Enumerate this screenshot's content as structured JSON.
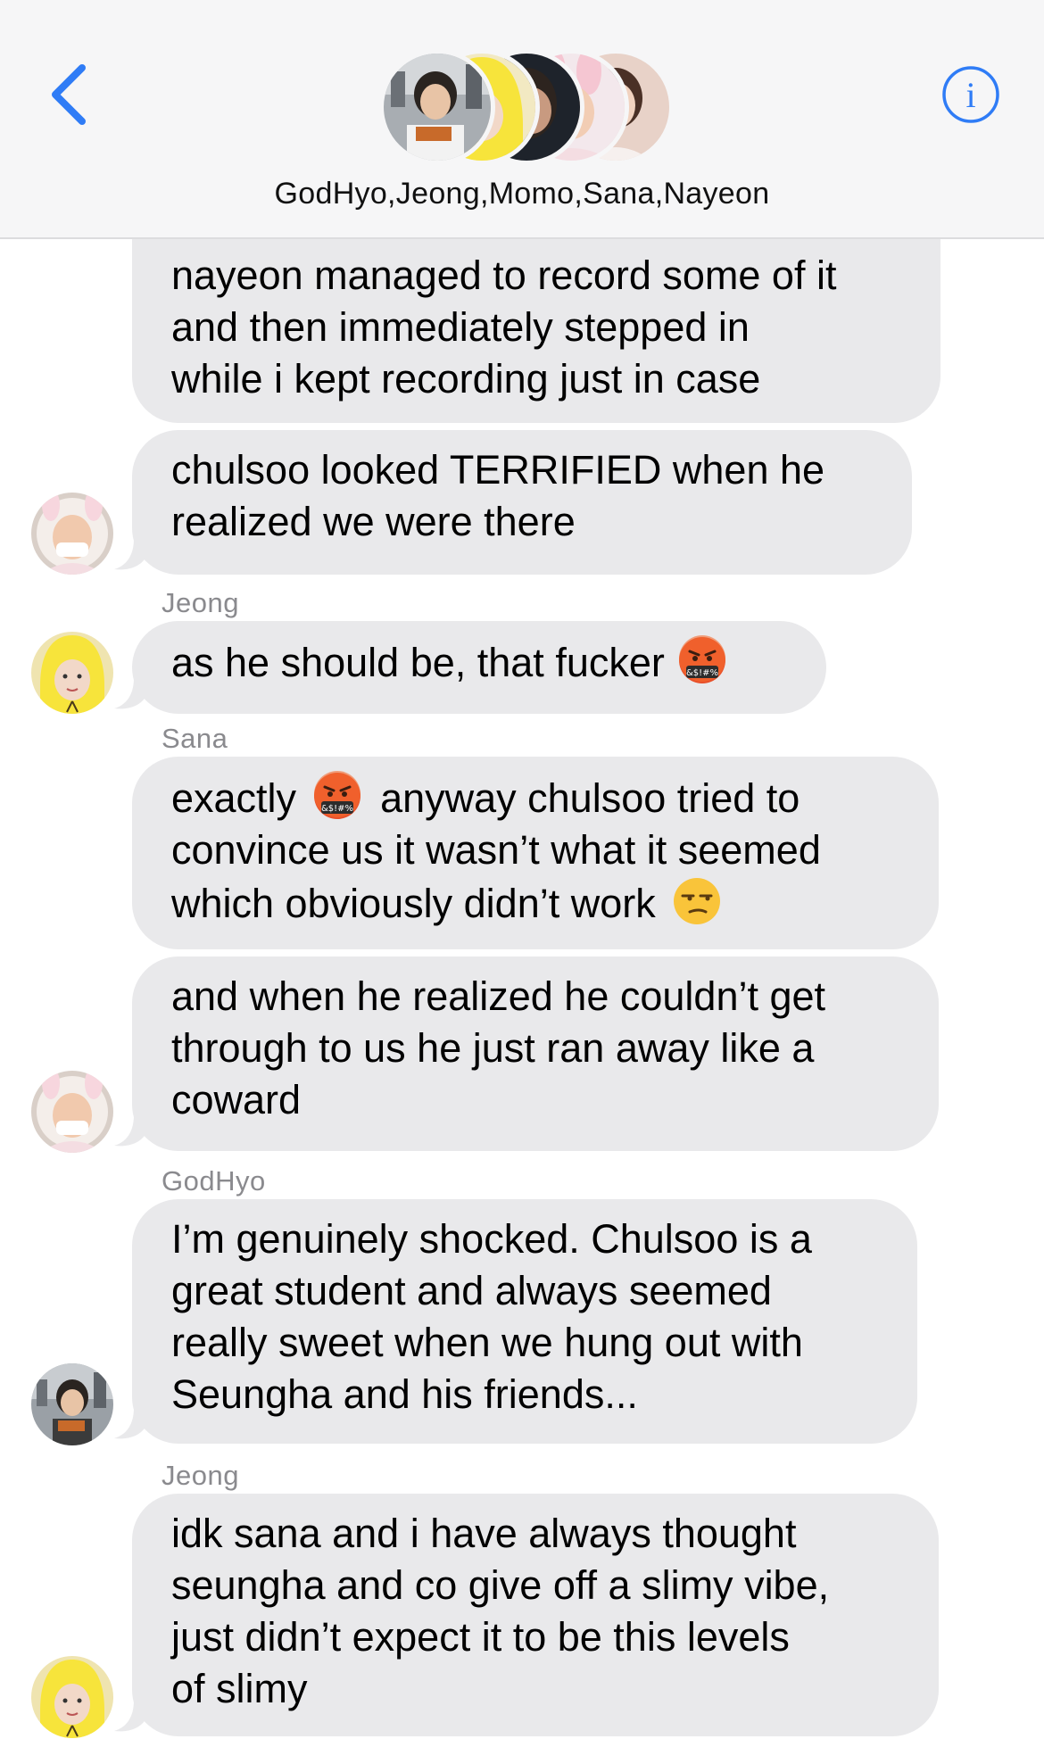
{
  "header": {
    "group_name": "GodHyo,Jeong,Momo,Sana,Nayeon",
    "back_icon": "chevron-left-icon",
    "info_icon": "info-circle-icon",
    "accent_color": "#2f7cf6"
  },
  "messages": [
    {
      "sender": "",
      "avatar": "",
      "lines": [
        "nayeon managed to record some of it",
        "and then immediately stepped in",
        "while i kept recording just in case"
      ]
    },
    {
      "sender": "",
      "avatar": "bunny-hood-avatar",
      "lines": [
        "chulsoo looked TERRIFIED when he",
        "realized we were there"
      ]
    },
    {
      "sender": "Jeong",
      "avatar": "yellow-hood-avatar",
      "lines": [
        "as he should be, that fucker"
      ],
      "emoji": [
        "cursing-face-emoji"
      ]
    },
    {
      "sender": "Sana",
      "avatar": "",
      "lines_parts": [
        {
          "before": "exactly",
          "after": "anyway chulsoo tried to"
        },
        {
          "text": "convince us it wasn’t what it seemed"
        },
        {
          "text": "which obviously didn’t work"
        }
      ],
      "emoji": [
        "cursing-face-emoji",
        "unamused-face-emoji"
      ]
    },
    {
      "sender": "",
      "avatar": "bunny-hood-avatar",
      "lines": [
        "and when he realized he couldn’t get",
        "through to us he just ran away like a",
        "coward"
      ]
    },
    {
      "sender": "GodHyo",
      "avatar": "city-photo-avatar",
      "lines": [
        "I’m genuinely shocked. Chulsoo is a",
        "great student and always seemed",
        "really sweet when we hung out with",
        "Seungha and his friends..."
      ]
    },
    {
      "sender": "Jeong",
      "avatar": "yellow-hood-avatar",
      "lines": [
        "idk sana and i have always thought",
        "seungha and co give off a slimy vibe,",
        "just didn’t expect it to be this levels",
        "of slimy"
      ]
    }
  ],
  "colors": {
    "bubble": "#e9e9eb",
    "header_bg": "#f6f6f7",
    "sender_text": "#8a8a8e"
  }
}
